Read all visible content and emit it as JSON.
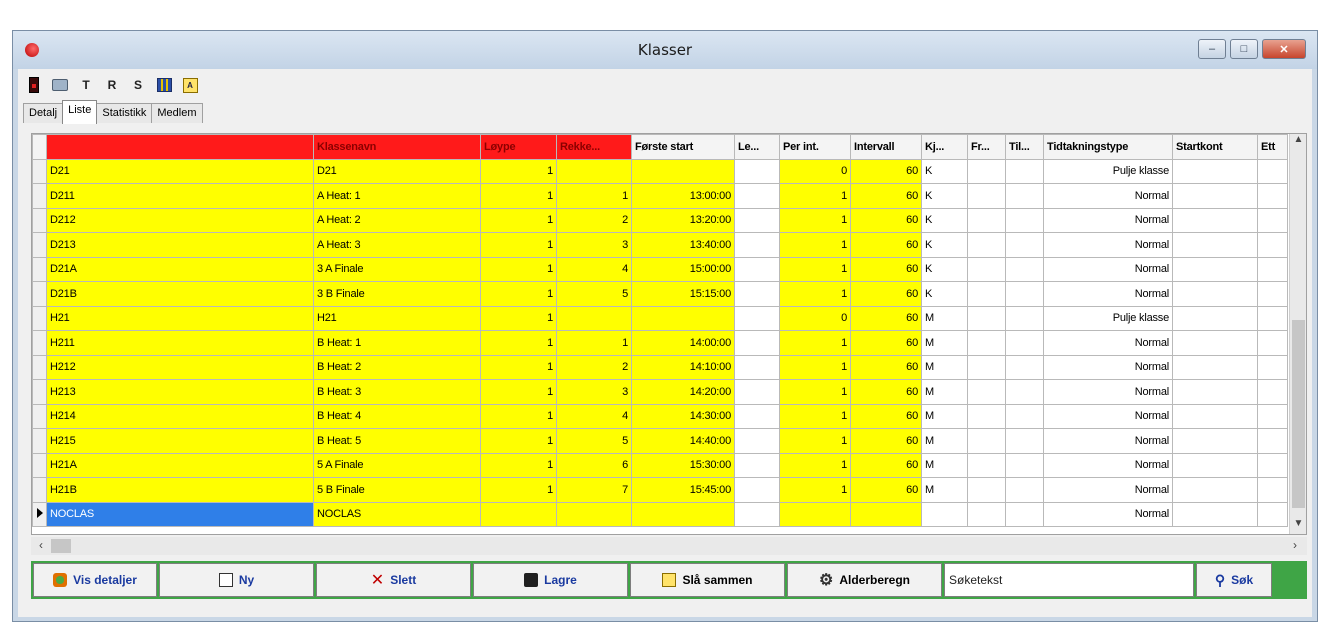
{
  "window": {
    "title": "Klasser"
  },
  "toolbar": {
    "t_label": "T",
    "r_label": "R",
    "s_label": "S"
  },
  "tabs": [
    {
      "label": "Detalj"
    },
    {
      "label": "Liste"
    },
    {
      "label": "Statistikk"
    },
    {
      "label": "Medlem"
    }
  ],
  "grid": {
    "headers": [
      "",
      "Klassenavn",
      "Løype",
      "Rekke...",
      "Første start",
      "Le...",
      "Per int.",
      "Intervall",
      "Kj...",
      "Fr...",
      "Til...",
      "Tidtakningstype",
      "Startkont",
      "Ett"
    ],
    "rows": [
      [
        "D21",
        "D21",
        "1",
        "",
        "",
        "",
        "0",
        "60",
        "K",
        "",
        "",
        "Pulje klasse",
        "",
        ""
      ],
      [
        "D211",
        "A Heat: 1",
        "1",
        "1",
        "13:00:00",
        "",
        "1",
        "60",
        "K",
        "",
        "",
        "Normal",
        "",
        ""
      ],
      [
        "D212",
        "A Heat: 2",
        "1",
        "2",
        "13:20:00",
        "",
        "1",
        "60",
        "K",
        "",
        "",
        "Normal",
        "",
        ""
      ],
      [
        "D213",
        "A Heat: 3",
        "1",
        "3",
        "13:40:00",
        "",
        "1",
        "60",
        "K",
        "",
        "",
        "Normal",
        "",
        ""
      ],
      [
        "D21A",
        "3 A Finale",
        "1",
        "4",
        "15:00:00",
        "",
        "1",
        "60",
        "K",
        "",
        "",
        "Normal",
        "",
        ""
      ],
      [
        "D21B",
        "3 B Finale",
        "1",
        "5",
        "15:15:00",
        "",
        "1",
        "60",
        "K",
        "",
        "",
        "Normal",
        "",
        ""
      ],
      [
        "H21",
        "H21",
        "1",
        "",
        "",
        "",
        "0",
        "60",
        "M",
        "",
        "",
        "Pulje klasse",
        "",
        ""
      ],
      [
        "H211",
        "B Heat: 1",
        "1",
        "1",
        "14:00:00",
        "",
        "1",
        "60",
        "M",
        "",
        "",
        "Normal",
        "",
        ""
      ],
      [
        "H212",
        "B Heat: 2",
        "1",
        "2",
        "14:10:00",
        "",
        "1",
        "60",
        "M",
        "",
        "",
        "Normal",
        "",
        ""
      ],
      [
        "H213",
        "B Heat: 3",
        "1",
        "3",
        "14:20:00",
        "",
        "1",
        "60",
        "M",
        "",
        "",
        "Normal",
        "",
        ""
      ],
      [
        "H214",
        "B Heat: 4",
        "1",
        "4",
        "14:30:00",
        "",
        "1",
        "60",
        "M",
        "",
        "",
        "Normal",
        "",
        ""
      ],
      [
        "H215",
        "B Heat: 5",
        "1",
        "5",
        "14:40:00",
        "",
        "1",
        "60",
        "M",
        "",
        "",
        "Normal",
        "",
        ""
      ],
      [
        "H21A",
        "5 A Finale",
        "1",
        "6",
        "15:30:00",
        "",
        "1",
        "60",
        "M",
        "",
        "",
        "Normal",
        "",
        ""
      ],
      [
        "H21B",
        "5 B Finale",
        "1",
        "7",
        "15:45:00",
        "",
        "1",
        "60",
        "M",
        "",
        "",
        "Normal",
        "",
        ""
      ],
      [
        "NOCLAS",
        "NOCLAS",
        "",
        "",
        "",
        "",
        "",
        "",
        "",
        "",
        "",
        "Normal",
        "",
        ""
      ]
    ]
  },
  "buttons": {
    "details": "Vis detaljer",
    "new": "Ny",
    "delete": "Slett",
    "save": "Lagre",
    "merge": "Slå sammen",
    "age": "Alderberegn",
    "search": "Søk"
  },
  "search": {
    "value": "Søketekst"
  },
  "colors": {
    "header_red": "#ff1a1a",
    "cell_yellow": "#ffff00",
    "selection_blue": "#2f7fe8",
    "button_bar_green": "#3fa546"
  }
}
